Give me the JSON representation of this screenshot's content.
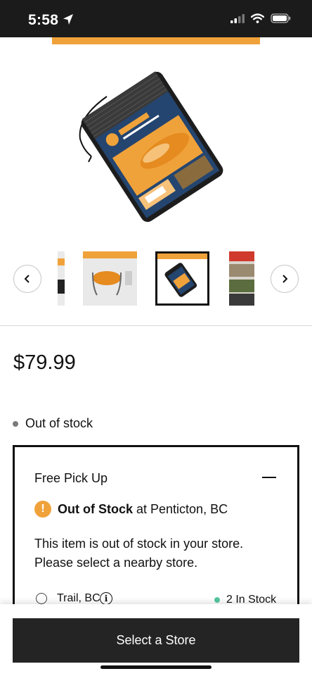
{
  "status_bar": {
    "time": "5:58",
    "icons": [
      "location-arrow-icon",
      "signal-icon",
      "wifi-icon",
      "battery-icon"
    ]
  },
  "gallery": {
    "hero_image": "kayak-carry-bag-product-image",
    "prev_icon": "chevron-left-icon",
    "next_icon": "chevron-right-icon",
    "thumbnails": [
      "thumbnail-1",
      "thumbnail-2",
      "thumbnail-3-selected",
      "thumbnail-4"
    ],
    "accent_color": "#f0a23a"
  },
  "product": {
    "price": "$79.99",
    "stock_status": "Out of stock"
  },
  "pickup": {
    "title": "Free Pick Up",
    "oos_label": "Out of Stock",
    "oos_location": " at Penticton, BC",
    "message": "This item is out of stock in your store. Please select a nearby store.",
    "stores": [
      {
        "name": "Trail, BC",
        "stock": "2 In Stock"
      }
    ]
  },
  "footer": {
    "select_store_label": "Select a Store"
  },
  "colors": {
    "accent_orange": "#f0a23a",
    "in_stock_green": "#56c7a2",
    "button_dark": "#242424"
  }
}
